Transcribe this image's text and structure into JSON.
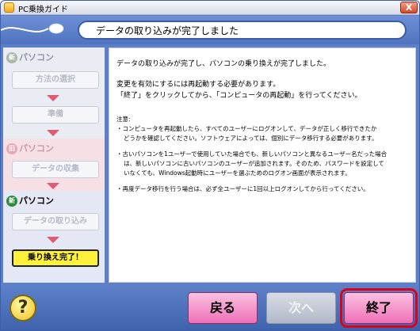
{
  "window": {
    "title": "PC乗換ガイド",
    "close_label": "X"
  },
  "header": {
    "title": "データの取り込みが完了しました"
  },
  "sidebar": {
    "sections": [
      {
        "badge": "新",
        "label": "パソコン",
        "steps": [
          "方法の選択",
          "準備"
        ]
      },
      {
        "badge": "旧",
        "label": "パソコン",
        "steps": [
          "データの収集"
        ]
      },
      {
        "badge": "新",
        "label": "パソコン",
        "steps": [
          "データの取り込み"
        ],
        "current": "乗り換え完了！"
      }
    ]
  },
  "content": {
    "line1": "データの取り込みが完了し、パソコンの乗り換えが完了しました。",
    "line2": "変更を有効にするには再起動する必要があります。",
    "line3": "「終了」をクリックしてから、「コンピュータの再起動」を行ってください。",
    "note_title": "注意:",
    "note1a": "・コンピュータを再起動したら、すべてのユーザーにログオンして、データが正しく移行できたか",
    "note1b": "どうかを確認してください。ソフトウェアによっては、個別にデータ移行する必要があります。",
    "note2a": "・古いパソコンを1ユーザーで使用していた場合でも、新しいパソコンと異なるユーザー名だった場合",
    "note2b": "は、新しいパソコンに古いパソコンのユーザーが追加されます。そのため、パスワードを設定して",
    "note2c": "いなくても、Windows起動時にユーザーを選ぶためのログオン画面が表示されます。",
    "note3": "・再度データ移行を行う場合は、必ず全ユーザーに1回以上ログオンしてから行ってください。"
  },
  "footer": {
    "help_label": "?",
    "back_label": "戻る",
    "next_label": "次へ",
    "finish_label": "終了"
  },
  "colors": {
    "accent": "#4f73bf",
    "highlight": "#e0001a",
    "button_pink": "#ef6fb7",
    "current_step": "#fff03a"
  }
}
